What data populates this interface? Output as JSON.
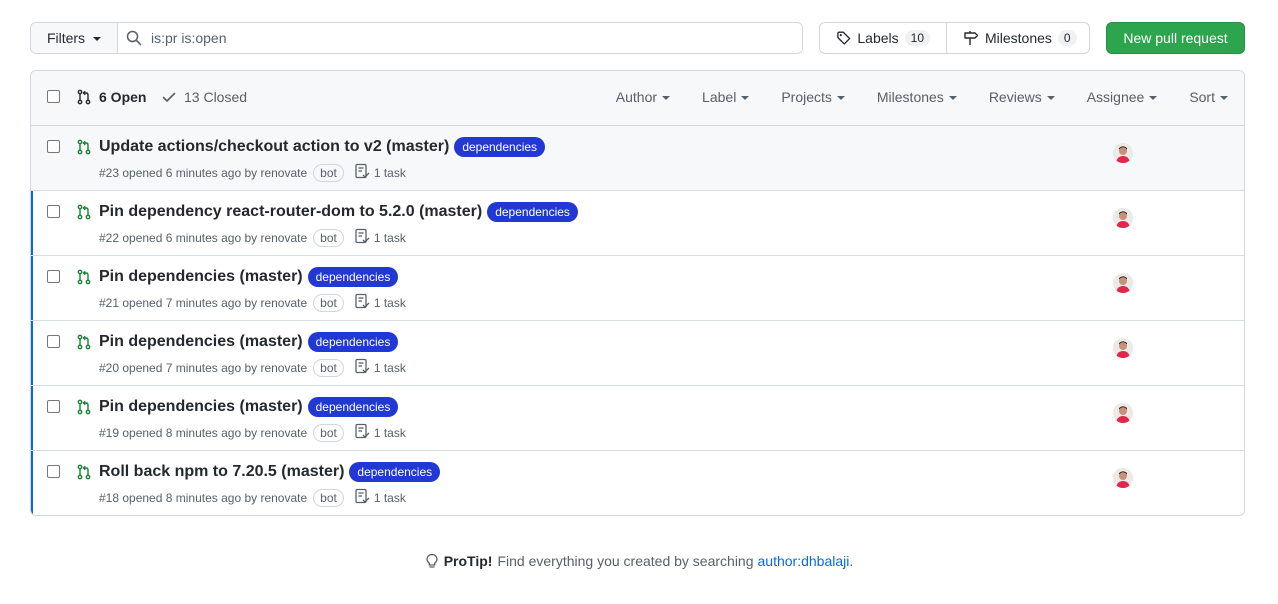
{
  "toolbar": {
    "filters_label": "Filters",
    "search_value": "is:pr is:open",
    "labels_label": "Labels",
    "labels_count": "10",
    "milestones_label": "Milestones",
    "milestones_count": "0",
    "new_pr_label": "New pull request"
  },
  "header": {
    "open_label": "6 Open",
    "closed_label": "13 Closed",
    "filters": [
      "Author",
      "Label",
      "Projects",
      "Milestones",
      "Reviews",
      "Assignee",
      "Sort"
    ]
  },
  "pulls": [
    {
      "title": "Update actions/checkout action to v2 (master)",
      "label": "dependencies",
      "meta": "#23 opened 6 minutes ago by renovate",
      "bot": "bot",
      "task": "1 task"
    },
    {
      "title": "Pin dependency react-router-dom to 5.2.0 (master)",
      "label": "dependencies",
      "meta": "#22 opened 6 minutes ago by renovate",
      "bot": "bot",
      "task": "1 task"
    },
    {
      "title": "Pin dependencies (master)",
      "label": "dependencies",
      "meta": "#21 opened 7 minutes ago by renovate",
      "bot": "bot",
      "task": "1 task"
    },
    {
      "title": "Pin dependencies (master)",
      "label": "dependencies",
      "meta": "#20 opened 7 minutes ago by renovate",
      "bot": "bot",
      "task": "1 task"
    },
    {
      "title": "Pin dependencies (master)",
      "label": "dependencies",
      "meta": "#19 opened 8 minutes ago by renovate",
      "bot": "bot",
      "task": "1 task"
    },
    {
      "title": "Roll back npm to 7.20.5 (master)",
      "label": "dependencies",
      "meta": "#18 opened 8 minutes ago by renovate",
      "bot": "bot",
      "task": "1 task"
    }
  ],
  "protip": {
    "bold": "ProTip!",
    "text": "Find everything you created by searching",
    "link": "author:dhbalaji",
    "end": "."
  },
  "colors": {
    "label_bg": "#2138d4",
    "open_icon": "#1a7f37",
    "new_pr_bg": "#2da44e",
    "link": "#0969da"
  }
}
